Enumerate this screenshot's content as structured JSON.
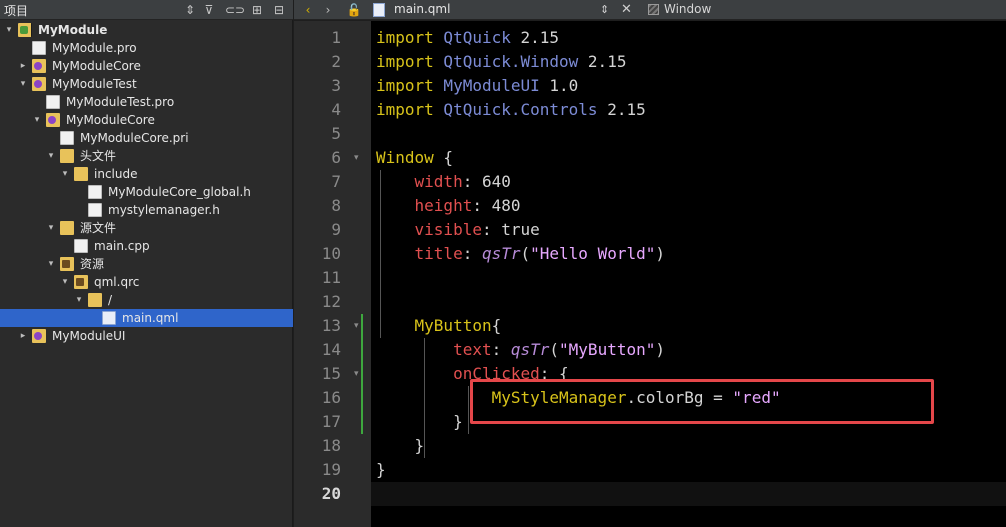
{
  "project_panel": {
    "title": "项目",
    "toolbar_icons": [
      "sort-icon",
      "filter-icon",
      "link-icon",
      "add-split-icon",
      "close-split-icon"
    ],
    "tree": [
      {
        "label": "MyModule",
        "kind": "project",
        "arrow": "▾",
        "bold": true
      },
      {
        "label": "MyModule.pro",
        "kind": "file"
      },
      {
        "label": "MyModuleCore",
        "kind": "subproject",
        "arrow": "▸"
      },
      {
        "label": "MyModuleTest",
        "kind": "subproject",
        "arrow": "▾"
      },
      {
        "label": "MyModuleTest.pro",
        "kind": "file"
      },
      {
        "label": "MyModuleCore",
        "kind": "subproject-folder",
        "arrow": "▾"
      },
      {
        "label": "MyModuleCore.pri",
        "kind": "file"
      },
      {
        "label": "头文件",
        "kind": "folder",
        "arrow": "▾"
      },
      {
        "label": "include",
        "kind": "folder",
        "arrow": "▾"
      },
      {
        "label": "MyModuleCore_global.h",
        "kind": "file"
      },
      {
        "label": "mystylemanager.h",
        "kind": "file"
      },
      {
        "label": "源文件",
        "kind": "folder",
        "arrow": "▾"
      },
      {
        "label": "main.cpp",
        "kind": "file"
      },
      {
        "label": "资源",
        "kind": "resource-folder",
        "arrow": "▾"
      },
      {
        "label": "qml.qrc",
        "kind": "resource",
        "arrow": "▾"
      },
      {
        "label": "/",
        "kind": "folder",
        "arrow": "▾"
      },
      {
        "label": "main.qml",
        "kind": "qml",
        "selected": true
      },
      {
        "label": "MyModuleUI",
        "kind": "subproject",
        "arrow": "▸"
      }
    ]
  },
  "editor": {
    "nav": [
      "‹",
      "›"
    ],
    "file_name": "main.qml",
    "symbol": "Window",
    "current_line": 20,
    "line_numbers": [
      "1",
      "2",
      "3",
      "4",
      "5",
      "6",
      "7",
      "8",
      "9",
      "10",
      "11",
      "12",
      "13",
      "14",
      "15",
      "16",
      "17",
      "18",
      "19",
      "20"
    ],
    "lines": [
      [
        [
          "k",
          "import"
        ],
        [
          "t",
          " QtQuick "
        ],
        [
          "w",
          "2.15"
        ]
      ],
      [
        [
          "k",
          "import"
        ],
        [
          "t",
          " QtQuick.Window "
        ],
        [
          "w",
          "2.15"
        ]
      ],
      [
        [
          "k",
          "import"
        ],
        [
          "t",
          " MyModuleUI "
        ],
        [
          "w",
          "1.0"
        ]
      ],
      [
        [
          "k",
          "import"
        ],
        [
          "t",
          " QtQuick.Controls "
        ],
        [
          "w",
          "2.15"
        ]
      ],
      [],
      [
        [
          "k",
          "Window"
        ],
        [
          "w",
          " {"
        ]
      ],
      [
        [
          "w",
          "    "
        ],
        [
          "p",
          "width"
        ],
        [
          "w",
          ": 640"
        ]
      ],
      [
        [
          "w",
          "    "
        ],
        [
          "p",
          "height"
        ],
        [
          "w",
          ": 480"
        ]
      ],
      [
        [
          "w",
          "    "
        ],
        [
          "p",
          "visible"
        ],
        [
          "w",
          ": true"
        ]
      ],
      [
        [
          "w",
          "    "
        ],
        [
          "p",
          "title"
        ],
        [
          "w",
          ": "
        ],
        [
          "f",
          "qsTr"
        ],
        [
          "w",
          "("
        ],
        [
          "s",
          "\"Hello World\""
        ],
        [
          "w",
          ")"
        ]
      ],
      [],
      [],
      [
        [
          "w",
          "    "
        ],
        [
          "k",
          "MyButton"
        ],
        [
          "w",
          "{"
        ]
      ],
      [
        [
          "w",
          "        "
        ],
        [
          "p",
          "text"
        ],
        [
          "w",
          ": "
        ],
        [
          "f",
          "qsTr"
        ],
        [
          "w",
          "("
        ],
        [
          "s",
          "\"MyButton\""
        ],
        [
          "w",
          ")"
        ]
      ],
      [
        [
          "w",
          "        "
        ],
        [
          "p",
          "onClicked"
        ],
        [
          "w",
          ": {"
        ]
      ],
      [
        [
          "w",
          "            "
        ],
        [
          "k",
          "MyStyleManager"
        ],
        [
          "w",
          ".colorBg = "
        ],
        [
          "s",
          "\"red\""
        ]
      ],
      [
        [
          "w",
          "        }"
        ]
      ],
      [
        [
          "w",
          "    }"
        ]
      ],
      [
        [
          "w",
          "}"
        ]
      ],
      []
    ]
  },
  "colors": {
    "keyword": "#d8c31a",
    "type": "#7c8bd5",
    "property": "#e15050",
    "string": "#e7a8ff",
    "function": "#b78bd8",
    "selection": "#2f65ca",
    "annotation_box": "#e5474a"
  }
}
